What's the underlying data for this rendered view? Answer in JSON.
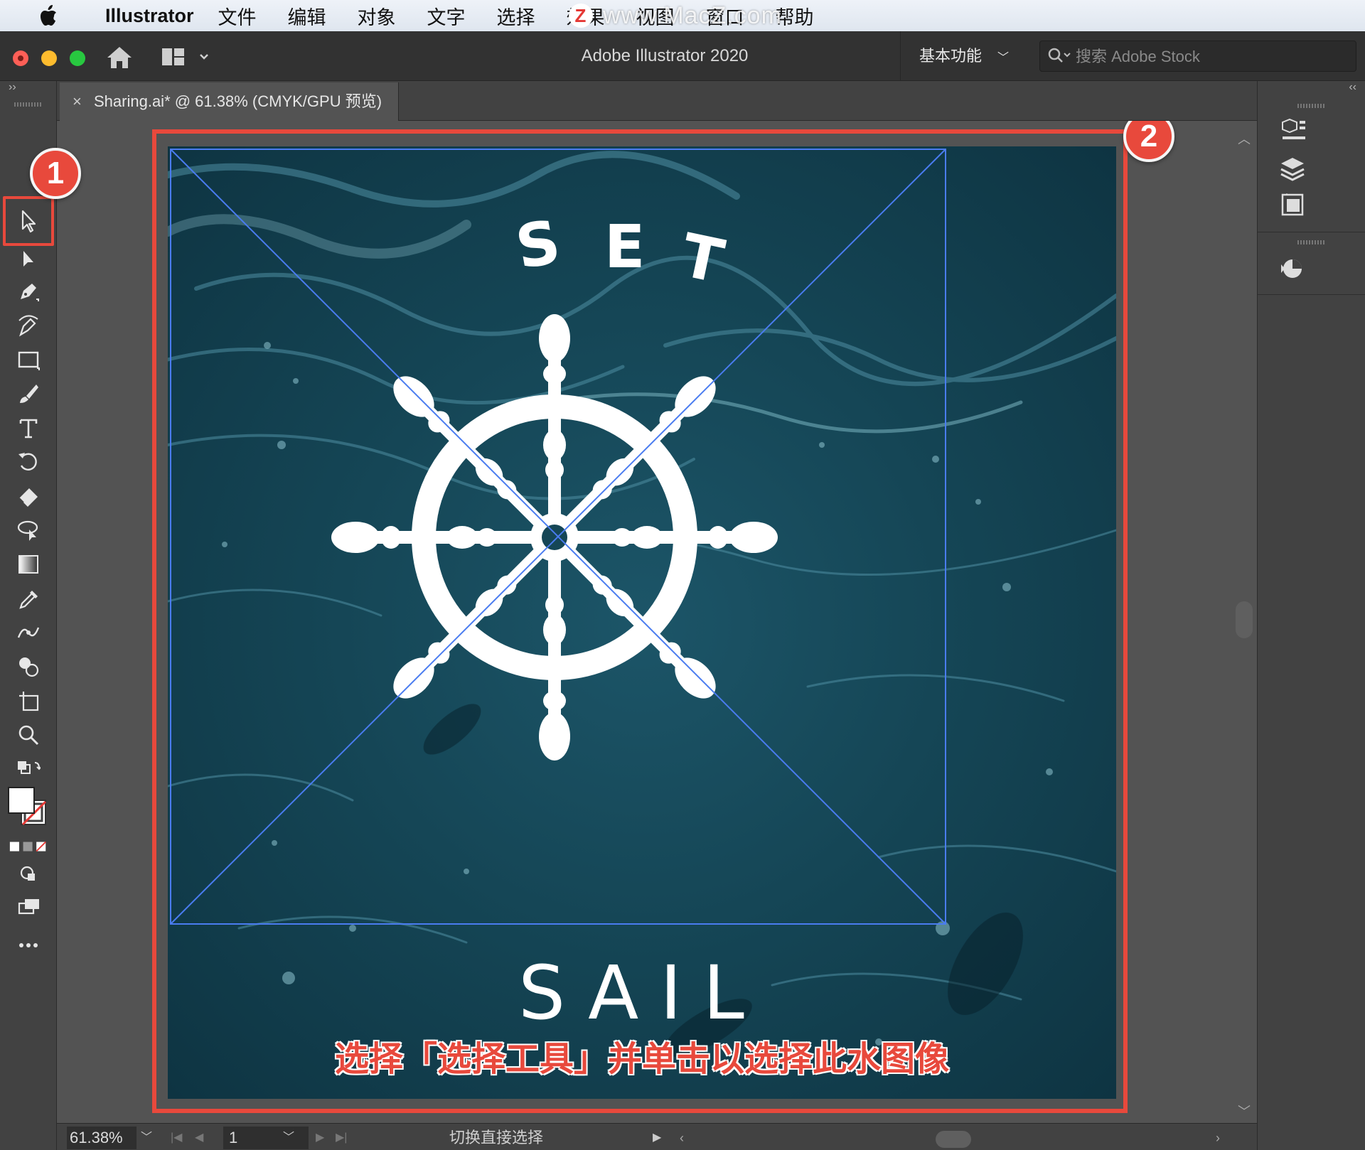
{
  "menubar": {
    "app_name": "Illustrator",
    "items": [
      "文件",
      "编辑",
      "对象",
      "文字",
      "选择",
      "效果",
      "视图",
      "窗口",
      "帮助"
    ],
    "watermark": "www.MacZ.com",
    "watermark_badge": "Z"
  },
  "titlebar": {
    "title": "Adobe Illustrator 2020",
    "workspace": "基本功能",
    "stock_placeholder": "搜索 Adobe Stock"
  },
  "document": {
    "tab_title": "Sharing.ai* @ 61.38% (CMYK/GPU 预览)",
    "close_glyph": "×"
  },
  "artwork": {
    "top_text": "SET",
    "bottom_text": "SAIL",
    "instruction": "选择「选择工具」并单击以选择此水图像",
    "ocean_color": "#154656",
    "highlight_color": "#e8493c",
    "selection_color": "#4a7cf0"
  },
  "badges": {
    "one": "1",
    "two": "2"
  },
  "tools": [
    "selection-tool",
    "direct-selection-tool",
    "pen-tool",
    "curvature-tool",
    "rectangle-tool",
    "paintbrush-tool",
    "type-tool",
    "rotate-tool",
    "eraser-tool",
    "lasso-tool",
    "gradient-tool",
    "eyedropper-tool",
    "width-tool",
    "shape-builder-tool",
    "artboard-tool",
    "zoom-tool"
  ],
  "right_panels": [
    "properties-icon",
    "layers-icon",
    "libraries-icon",
    "color-guide-icon"
  ],
  "statusbar": {
    "zoom": "61.38%",
    "page": "1",
    "status": "切换直接选择"
  }
}
